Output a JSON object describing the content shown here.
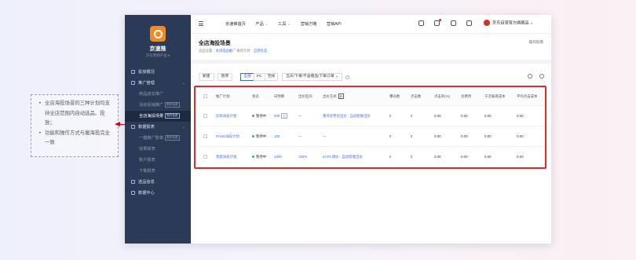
{
  "annotation": {
    "items": [
      "全店海投场景的三种计划均支持全店范围内自动选品、投放；",
      "功能和操作方式与搬海投完全一致"
    ]
  },
  "app": {
    "brand": "京速推",
    "brand_sub": "京东营销产品 ▾",
    "sidebar": {
      "items": [
        {
          "label": "投放概况",
          "kind": "group"
        },
        {
          "label": "推广管理",
          "kind": "group",
          "chevron": "⌄"
        },
        {
          "label": "商品成长推广",
          "kind": "sub"
        },
        {
          "label": "活动促销推广",
          "kind": "sub",
          "tag": "限时免费"
        },
        {
          "label": "全店海投场景",
          "kind": "sub active",
          "tag": "限时免费"
        },
        {
          "label": "数据报表",
          "kind": "group",
          "chevron": "⌄"
        },
        {
          "label": "一键推广账单",
          "kind": "sub",
          "tag": "限时免费"
        },
        {
          "label": "效果报表",
          "kind": "sub"
        },
        {
          "label": "账户报表",
          "kind": "sub"
        },
        {
          "label": "下载报表",
          "kind": "sub"
        },
        {
          "label": "选品信息",
          "kind": "group"
        },
        {
          "label": "数据中心",
          "kind": "group"
        }
      ]
    },
    "topnav": [
      "京速推首页",
      "产品",
      "工具",
      "营销方略",
      "营销API"
    ],
    "shop_name": "京东自营官方旗舰店 ⌄",
    "page_title": "全店海投场景",
    "help_link": "操作指南",
    "breadcrumb": {
      "prefix": "选品设置：",
      "link1": "关闭选品推广",
      "mid": "   推荐页目：",
      "link2": "自营优选"
    },
    "toolbar": {
      "btn_new": "新建",
      "btn_batch": "暂停",
      "segments": [
        "全部",
        "PC",
        "无线"
      ],
      "select": "当天/下单/不含赠品/下单订单 ⌄"
    },
    "table": {
      "headers": [
        "推广计划",
        "状态",
        "日预算",
        "出价区间",
        "出价方式",
        "曝光数",
        "点击数",
        "点击率(%)",
        "总费用",
        "千次展现成本",
        "平均点击成本"
      ],
      "rows": [
        {
          "name": "优商海投计划",
          "status": "暂停中",
          "budget": "500",
          "budget_tag": "日",
          "range": "---",
          "bid": "重点优势化出价 · 自动智能出价",
          "imp": "0",
          "clk": "0",
          "ctr": "0.00",
          "cost": "0.00",
          "cpm": "0.00",
          "cpc": "0.00"
        },
        {
          "name": "PUSH海投计划",
          "status": "暂停中",
          "budget": "100",
          "budget_tag": "",
          "range": "---",
          "bid": "---",
          "imp": "0",
          "clk": "0",
          "ctr": "0.00",
          "cost": "0.00",
          "cpm": "0.00",
          "cpc": "0.00"
        },
        {
          "name": "直客海投计划",
          "status": "暂停中",
          "budget": "1000",
          "budget_tag": "",
          "range": "100%",
          "bid": "eCPC调价 · 自动智能出价",
          "imp": "0",
          "clk": "0",
          "ctr": "0.00",
          "cost": "0.00",
          "cpm": "0.00",
          "cpc": "0.00"
        }
      ]
    }
  },
  "colors": {
    "sidebar": "#2b3a57",
    "accent": "#3d6fd8",
    "highlight": "#e0292c",
    "logo": "#f08a24"
  }
}
